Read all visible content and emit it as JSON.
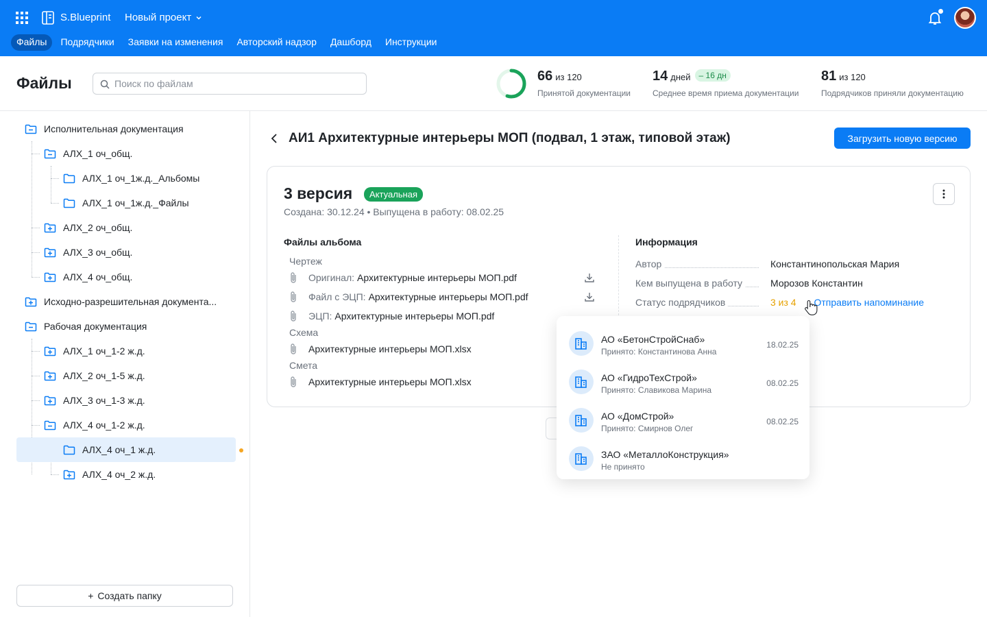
{
  "topbar": {
    "brand": "S.Blueprint",
    "project": "Новый проект",
    "nav": [
      "Файлы",
      "Подрядчики",
      "Заявки на изменения",
      "Авторский надзор",
      "Дашборд",
      "Инструкции"
    ],
    "active_tab": "Файлы"
  },
  "header": {
    "title": "Файлы",
    "search_placeholder": "Поиск по файлам",
    "stats": [
      {
        "value": "66",
        "unit": "из 120",
        "caption": "Принятой документации",
        "progress": 0.55
      },
      {
        "value": "14",
        "unit": "дней",
        "badge": "– 16 дн",
        "caption": "Среднее время приема документации"
      },
      {
        "value": "81",
        "unit": "из 120",
        "caption": "Подрядчиков приняли документацию"
      }
    ]
  },
  "tree": [
    {
      "label": "Исполнительная документация",
      "level": 0,
      "state": "open"
    },
    {
      "label": "АЛХ_1 оч_общ.",
      "level": 1,
      "state": "open"
    },
    {
      "label": "АЛХ_1 оч_1ж.д._Альбомы",
      "level": 2,
      "state": "folder"
    },
    {
      "label": "АЛХ_1 оч_1ж.д._Файлы",
      "level": 2,
      "state": "folder"
    },
    {
      "label": "АЛХ_2 оч_общ.",
      "level": 1,
      "state": "closed"
    },
    {
      "label": "АЛХ_3 оч_общ.",
      "level": 1,
      "state": "closed"
    },
    {
      "label": "АЛХ_4 оч_общ.",
      "level": 1,
      "state": "closed"
    },
    {
      "label": "Исходно-разрешительная документа...",
      "level": 0,
      "state": "closed"
    },
    {
      "label": "Рабочая документация",
      "level": 0,
      "state": "open"
    },
    {
      "label": "АЛХ_1 оч_1-2 ж.д.",
      "level": 1,
      "state": "closed"
    },
    {
      "label": "АЛХ_2 оч_1-5 ж.д.",
      "level": 1,
      "state": "closed"
    },
    {
      "label": "АЛХ_3 оч_1-3 ж.д.",
      "level": 1,
      "state": "closed"
    },
    {
      "label": "АЛХ_4 оч_1-2 ж.д.",
      "level": 1,
      "state": "open"
    },
    {
      "label": "АЛХ_4 оч_1 ж.д.",
      "level": 2,
      "state": "folder",
      "selected": true
    },
    {
      "label": "АЛХ_4 оч_2 ж.д.",
      "level": 2,
      "state": "closed"
    }
  ],
  "create_folder": "Создать папку",
  "document": {
    "title": "АИ1 Архитектурные интерьеры МОП (подвал, 1 этаж, типовой этаж)",
    "upload_button": "Загрузить новую версию",
    "version": "3 версия",
    "version_badge": "Актуальная",
    "meta": "Создана: 30.12.24  •  Выпущена в работу: 08.02.25",
    "files_title": "Файлы альбома",
    "groups": {
      "drawing": "Чертеж",
      "scheme": "Схема",
      "estimate": "Смета"
    },
    "files": [
      {
        "prefix": "Оригинал:",
        "name": "Архитектурные интерьеры МОП.pdf",
        "download": true
      },
      {
        "prefix": "Файл с ЭЦП:",
        "name": "Архитектурные интерьеры МОП.pdf",
        "download": true
      },
      {
        "prefix": "ЭЦП:",
        "name": "Архитектурные интерьеры МОП.pdf",
        "download": false
      },
      {
        "prefix": "",
        "name": "Архитектурные интерьеры МОП.xlsx",
        "download": false
      },
      {
        "prefix": "",
        "name": "Архитектурные интерьеры МОП.xlsx",
        "download": false
      }
    ],
    "info_title": "Информация",
    "info": {
      "author_label": "Автор",
      "author": "Константинопольская Мария",
      "released_label": "Кем выпущена в работу",
      "released_by": "Морозов Константин",
      "status_label": "Статус подрядчиков",
      "status_count": "3 из 4",
      "remind": "Отправить напоминание"
    }
  },
  "contractors": [
    {
      "name": "АО «БетонСтройСнаб»",
      "status": "Принято: Константинова Анна",
      "date": "18.02.25"
    },
    {
      "name": "АО «ГидроТехСтрой»",
      "status": "Принято: Славикова Марина",
      "date": "08.02.25"
    },
    {
      "name": "АО «ДомСтрой»",
      "status": "Принято: Смирнов Олег",
      "date": "08.02.25"
    },
    {
      "name": "ЗАО «МеталлоКонструкция»",
      "status": "Не принято",
      "date": ""
    }
  ],
  "colors": {
    "primary": "#0a7cf5",
    "success": "#1aa35a",
    "warning": "#e6a100"
  }
}
